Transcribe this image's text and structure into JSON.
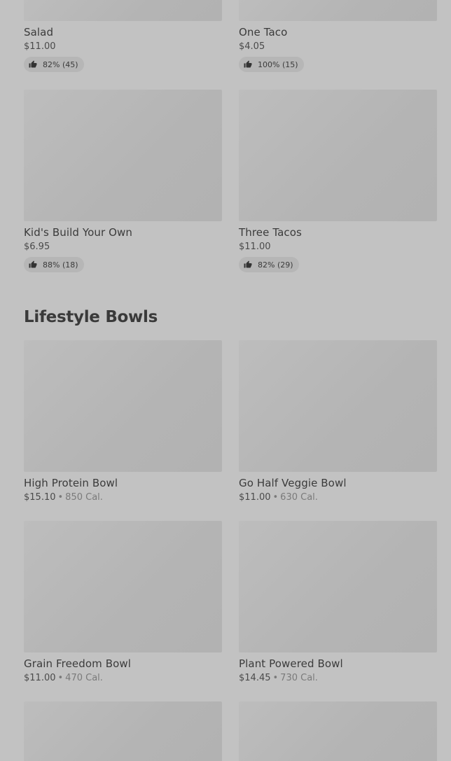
{
  "top_items": [
    {
      "name": "Salad",
      "price": "$11.00",
      "rating": "82% (45)"
    },
    {
      "name": "One Taco",
      "price": "$4.05",
      "rating": "100% (15)"
    },
    {
      "name": "Kid's Build Your Own",
      "price": "$6.95",
      "rating": "88% (18)"
    },
    {
      "name": "Three Tacos",
      "price": "$11.00",
      "rating": "82% (29)"
    }
  ],
  "lifestyle": {
    "title": "Lifestyle Bowls",
    "separator": "•",
    "items": [
      {
        "name": "High Protein Bowl",
        "price": "$15.10",
        "calories": "850 Cal."
      },
      {
        "name": "Go Half Veggie Bowl",
        "price": "$11.00",
        "calories": "630 Cal."
      },
      {
        "name": "Grain Freedom Bowl",
        "price": "$11.00",
        "calories": "470 Cal."
      },
      {
        "name": "Plant Powered Bowl",
        "price": "$14.45",
        "calories": "730 Cal."
      }
    ]
  },
  "icons": {
    "rating": "thumbs-up-icon"
  },
  "colors": {
    "background": "#c2c2c2",
    "image_placeholder": "#b4b4b4",
    "rating_pill": "#b6b6b6"
  }
}
